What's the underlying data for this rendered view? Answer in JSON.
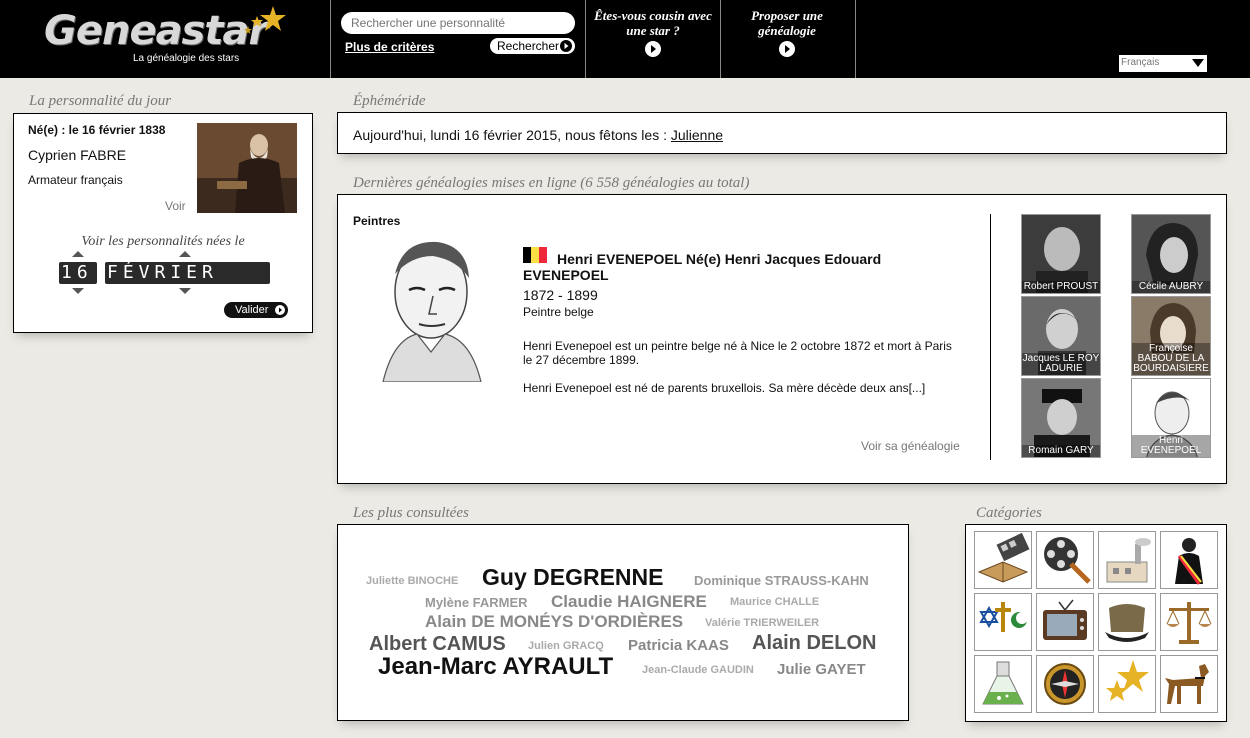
{
  "header": {
    "logo_text": "Geneastar",
    "tagline": "La généalogie des stars",
    "search_placeholder": "Rechercher une personnalité",
    "more_criteria": "Plus de critères",
    "search_button": "Rechercher",
    "menu_cousin_line1": "Êtes-vous cousin avec",
    "menu_cousin_line2": "une star ?",
    "menu_propose_line1": "Proposer une",
    "menu_propose_line2": "généalogie",
    "language": "Français"
  },
  "personality_of_day": {
    "section_title": "La personnalité du jour",
    "born": "Né(e) : le 16 février 1838",
    "name": "Cyprien FABRE",
    "description": "Armateur français",
    "see_link": "Voir",
    "see_born_label": "Voir les personnalités nées le",
    "day": "16",
    "month": "FÉVRIER",
    "validate_button": "Valider"
  },
  "ephemeride": {
    "section_title": "Éphéméride",
    "text": "Aujourd'hui, lundi 16 février 2015, nous fêtons les :",
    "saint": "Julienne"
  },
  "latest_genealogies": {
    "section_title": "Dernières généalogies mises en ligne (6 558 généalogies au total)",
    "category": "Peintres",
    "featured": {
      "name": "Henri EVENEPOEL Né(e) Henri Jacques Edouard EVENEPOEL",
      "years": "1872 - 1899",
      "occupation": "Peintre belge",
      "paragraph1": "Henri Evenepoel est un peintre belge né à Nice le 2 octobre 1872 et mort à Paris le 27 décembre 1899.",
      "paragraph2": "Henri Evenepoel est né de parents bruxellois. Sa mère décède deux ans[...]",
      "see_genealogy": "Voir sa généalogie"
    },
    "thumbnails": [
      {
        "label": "Robert PROUST"
      },
      {
        "label": "Cécile AUBRY"
      },
      {
        "label": "Jacques LE ROY LADURIE"
      },
      {
        "label": "Françoise BABOU DE LA BOURDAISIERE"
      },
      {
        "label": "Romain GARY"
      },
      {
        "label": "Henri EVENEPOEL"
      }
    ],
    "flag_colors": [
      "#000000",
      "#FAE042",
      "#ED2939"
    ]
  },
  "most_viewed": {
    "section_title": "Les plus consultées",
    "tags": [
      {
        "text": "Juliette BINOCHE"
      },
      {
        "text": "Guy DEGRENNE"
      },
      {
        "text": "Dominique STRAUSS-KAHN"
      },
      {
        "text": "Mylène FARMER"
      },
      {
        "text": "Claudie HAIGNERE"
      },
      {
        "text": "Maurice CHALLE"
      },
      {
        "text": "Alain DE MONÉYS D'ORDIÈRES"
      },
      {
        "text": "Valérie TRIERWEILER"
      },
      {
        "text": "Albert CAMUS"
      },
      {
        "text": "Julien GRACQ"
      },
      {
        "text": "Patricia KAAS"
      },
      {
        "text": "Alain DELON"
      },
      {
        "text": "Jean-Marc AYRAULT"
      },
      {
        "text": "Jean-Claude GAUDIN"
      },
      {
        "text": "Julie GAYET"
      }
    ]
  },
  "categories": {
    "section_title": "Catégories",
    "icons": [
      "film-book-icon",
      "film-reel-icon",
      "factory-icon",
      "politician-icon",
      "religion-icon",
      "television-icon",
      "military-cap-icon",
      "justice-scales-icon",
      "science-flask-icon",
      "compass-icon",
      "stars-icon",
      "dog-icon"
    ]
  }
}
